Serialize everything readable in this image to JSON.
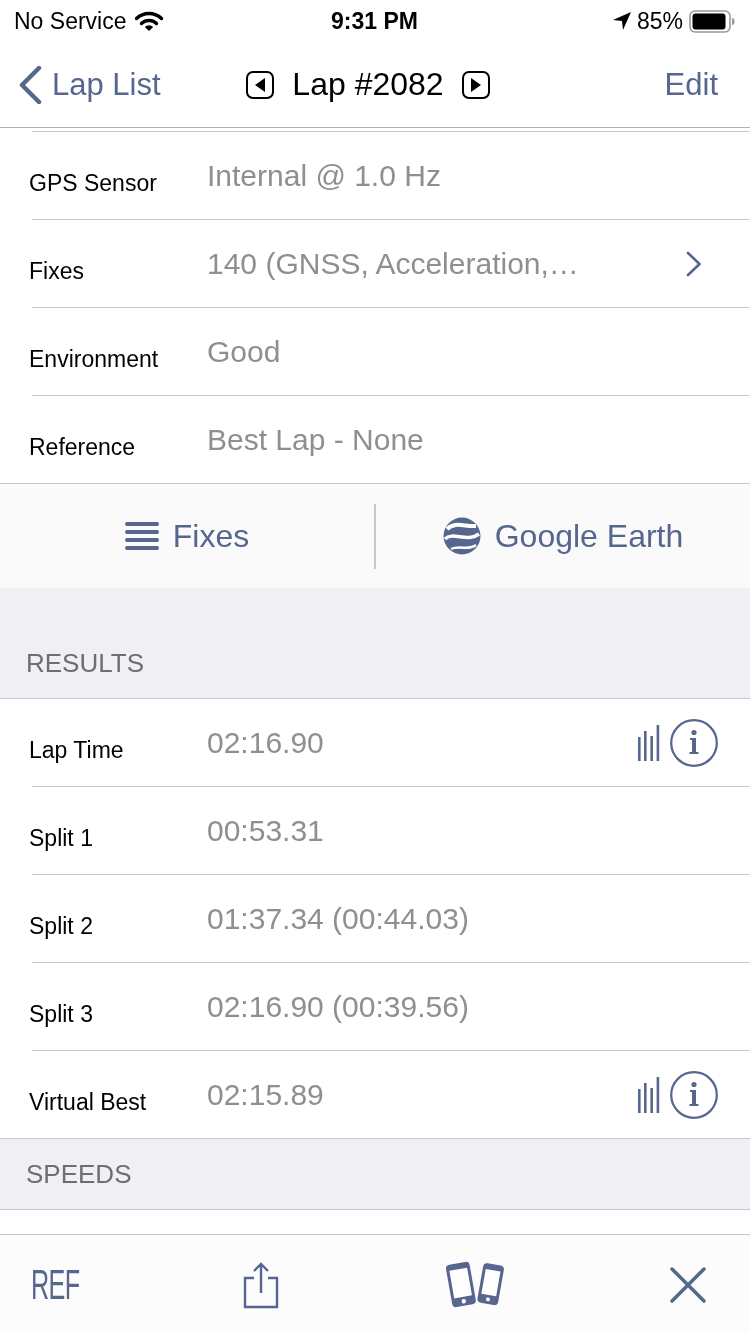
{
  "status_bar": {
    "carrier": "No Service",
    "time": "9:31 PM",
    "battery_percent": "85%"
  },
  "nav_bar": {
    "back_label": "Lap List",
    "title": "Lap #2082",
    "action": "Edit"
  },
  "details": [
    {
      "label": "GPS Sensor",
      "value": "Internal @ 1.0 Hz",
      "disclosure": false
    },
    {
      "label": "Fixes",
      "value": "140 (GNSS, Acceleration,…",
      "disclosure": true
    },
    {
      "label": "Environment",
      "value": "Good",
      "disclosure": false
    },
    {
      "label": "Reference",
      "value": "Best Lap - None",
      "disclosure": false
    }
  ],
  "actions": [
    {
      "kind": "list",
      "label": "Fixes"
    },
    {
      "kind": "globe",
      "label": "Google Earth"
    }
  ],
  "sections": [
    {
      "header": "RESULTS",
      "rows": [
        {
          "label": "Lap Time",
          "value": "02:16.90",
          "detail_buttons": true
        },
        {
          "label": "Split 1",
          "value": "00:53.31",
          "detail_buttons": false
        },
        {
          "label": "Split 2",
          "value": "01:37.34 (00:44.03)",
          "detail_buttons": false
        },
        {
          "label": "Split 3",
          "value": "02:16.90 (00:39.56)",
          "detail_buttons": false
        },
        {
          "label": "Virtual Best",
          "value": "02:15.89",
          "detail_buttons": true
        }
      ]
    },
    {
      "header": "SPEEDS"
    }
  ],
  "toolbar": [
    {
      "kind": "ref",
      "label": "REF"
    },
    {
      "kind": "share"
    },
    {
      "kind": "devices"
    },
    {
      "kind": "close"
    }
  ]
}
